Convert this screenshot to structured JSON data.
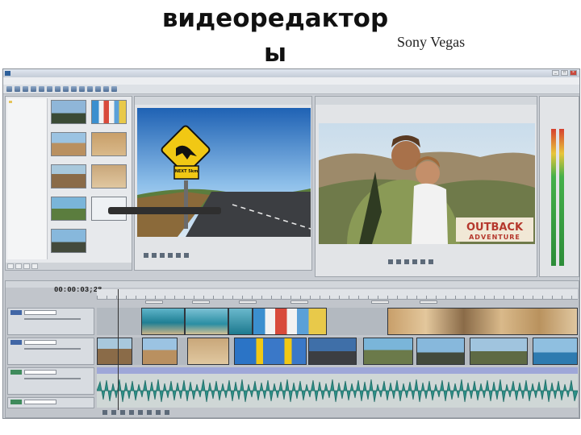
{
  "slide": {
    "title": "видеоредактор ы",
    "subtitle": "Sony Vegas"
  },
  "screenshot": {
    "window": {
      "title": "",
      "controls": [
        "_",
        "□",
        "×"
      ]
    },
    "menu": [
      "",
      "",
      "",
      "",
      "",
      "",
      ""
    ],
    "overlay_text": {
      "road_sign": "NEXT 5km",
      "banner_line1": "OUTBACK",
      "banner_line2": "ADVENTURE"
    },
    "timeline": {
      "timecode": "00:00:03;28"
    },
    "colors": {
      "accent": "#4166a5",
      "banner_red": "#b5372c",
      "wave_green": "#2d8f87"
    }
  }
}
